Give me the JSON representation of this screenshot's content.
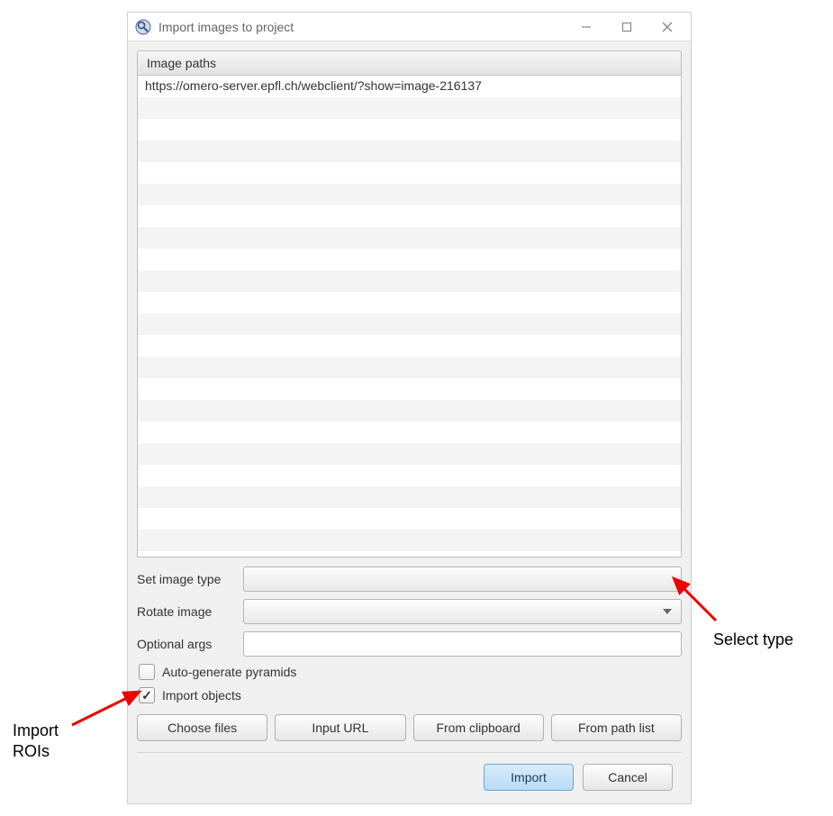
{
  "window": {
    "title": "Import images to project"
  },
  "paths_panel": {
    "header": "Image paths",
    "rows": [
      "https://omero-server.epfl.ch/webclient/?show=image-216137",
      "",
      "",
      "",
      "",
      "",
      "",
      "",
      "",
      "",
      "",
      "",
      "",
      "",
      "",
      "",
      "",
      "",
      "",
      "",
      "",
      ""
    ]
  },
  "form": {
    "set_image_type_label": "Set image type",
    "rotate_image_label": "Rotate image",
    "optional_args_label": "Optional args",
    "optional_args_value": "",
    "auto_generate_pyramids_label": "Auto-generate pyramids",
    "auto_generate_pyramids_checked": false,
    "import_objects_label": "Import objects",
    "import_objects_checked": true
  },
  "buttons": {
    "choose_files": "Choose files",
    "input_url": "Input URL",
    "from_clipboard": "From clipboard",
    "from_path_list": "From path list",
    "import": "Import",
    "cancel": "Cancel"
  },
  "annotations": {
    "select_type": "Select type",
    "import_rois_line1": "Import",
    "import_rois_line2": "ROIs"
  }
}
